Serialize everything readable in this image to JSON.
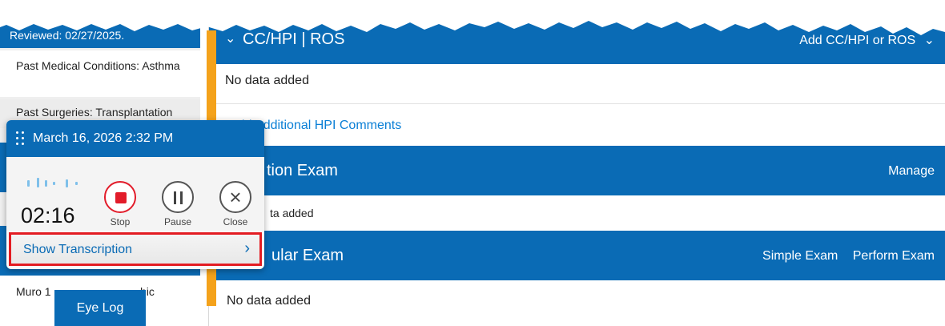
{
  "left_panel": {
    "reviewed_text": "Reviewed: 02/27/2025.",
    "past_medical": "Past Medical Conditions: Asthma",
    "past_surgeries": "Past Surgeries: Transplantation",
    "muro_text": "Muro 1",
    "muro_tail": "hic",
    "eye_log_label": "Eye Log"
  },
  "sections": {
    "cc_hpi": {
      "title": "CC/HPI | ROS",
      "action": "Add CC/HPI or ROS",
      "no_data": "No data added",
      "add_comments_link": "Add Additional HPI Comments"
    },
    "exam1": {
      "title_partial": "tion Exam",
      "action": "Manage",
      "no_data_partial": "ta added"
    },
    "exam2": {
      "title_partial": "ular Exam",
      "actions": [
        "Simple Exam",
        "Perform Exam"
      ],
      "no_data": "No data added"
    }
  },
  "recorder": {
    "datetime": "March 16, 2026 2:32 PM",
    "timer": "02:16",
    "stop_label": "Stop",
    "pause_label": "Pause",
    "close_label": "Close",
    "show_transcription_label": "Show Transcription",
    "chevron": "›"
  },
  "colors": {
    "primary_blue": "#0a6bb5",
    "accent_orange": "#f4a21b",
    "record_red": "#e21c2a",
    "highlight_red": "#e31c22"
  },
  "icons": [
    "drag-handle-icon",
    "waveform-icon",
    "stop-icon",
    "pause-icon",
    "close-icon",
    "chevron-right-icon",
    "chevron-down-icon"
  ]
}
